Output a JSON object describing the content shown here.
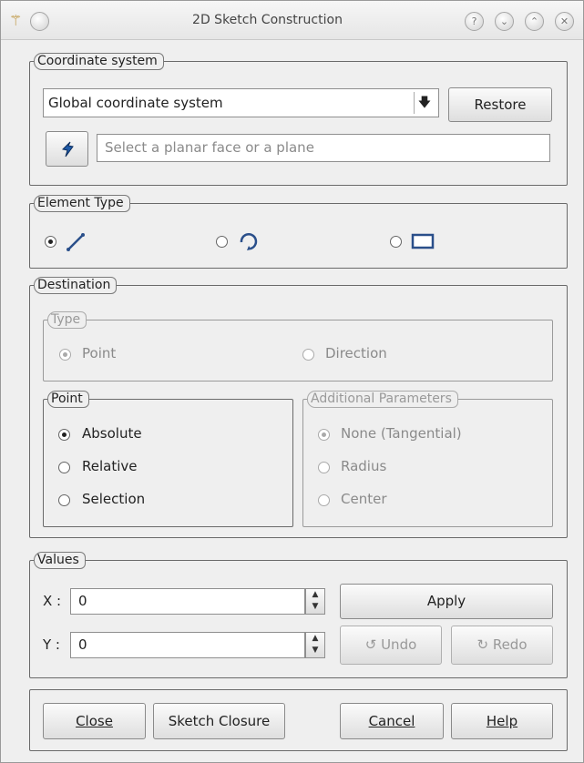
{
  "window": {
    "title": "2D Sketch Construction"
  },
  "coordinate_system": {
    "legend": "Coordinate system",
    "selected": "Global coordinate system",
    "restore_label": "Restore",
    "plane_placeholder": "Select a planar face or a plane"
  },
  "element_type": {
    "legend": "Element Type"
  },
  "destination": {
    "legend": "Destination",
    "type": {
      "legend": "Type",
      "point": "Point",
      "direction": "Direction"
    },
    "point": {
      "legend": "Point",
      "absolute": "Absolute",
      "relative": "Relative",
      "selection": "Selection"
    },
    "additional": {
      "legend": "Additional Parameters",
      "none": "None (Tangential)",
      "radius": "Radius",
      "center": "Center"
    }
  },
  "values": {
    "legend": "Values",
    "x_label": "X :",
    "x_value": "0",
    "y_label": "Y :",
    "y_value": "0",
    "apply_label": "Apply",
    "undo_label": "Undo",
    "redo_label": "Redo"
  },
  "bottom": {
    "close_label": "Close",
    "sketch_closure_label": "Sketch Closure",
    "cancel_label": "Cancel",
    "help_label": "Help"
  }
}
